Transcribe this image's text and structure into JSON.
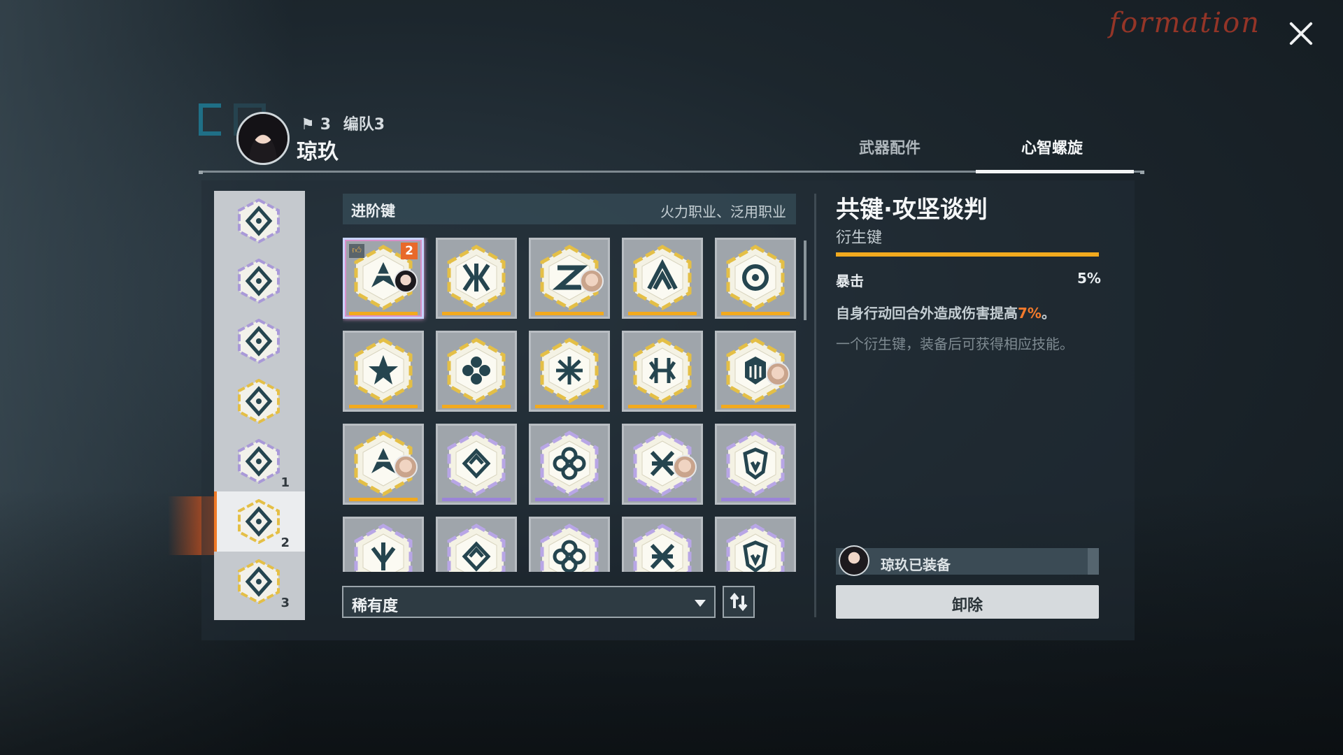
{
  "watermark": "formation",
  "character": {
    "team_number": "3",
    "team_name": "编队3",
    "name": "琼玖"
  },
  "tabs": [
    {
      "label": "武器配件",
      "active": false
    },
    {
      "label": "心智螺旋",
      "active": true
    }
  ],
  "sidebar": {
    "items": [
      {
        "icon": "diamond-rune-icon",
        "count": ""
      },
      {
        "icon": "tree-rune-icon",
        "count": ""
      },
      {
        "icon": "knot-rune-icon",
        "count": ""
      },
      {
        "icon": "star-rune-icon",
        "count": ""
      },
      {
        "icon": "eye-rune-icon",
        "count": "1"
      },
      {
        "icon": "arrow-rune-icon",
        "count": "2",
        "active": true
      },
      {
        "icon": "s-rune-icon",
        "count": "3"
      }
    ]
  },
  "category": {
    "title": "进阶键",
    "subtitle": "火力职业、泛用职业"
  },
  "keys": [
    {
      "icon": "arrow-key-icon",
      "rarity": "gold",
      "owner": "dark",
      "badge": "2",
      "selected": true,
      "recommended": true
    },
    {
      "icon": "wave-key-icon",
      "rarity": "gold"
    },
    {
      "icon": "z-key-icon",
      "rarity": "gold",
      "owner": "light"
    },
    {
      "icon": "peak-key-icon",
      "rarity": "gold"
    },
    {
      "icon": "orbit-key-icon",
      "rarity": "gold"
    },
    {
      "icon": "star-key-icon",
      "rarity": "gold"
    },
    {
      "icon": "clover-key-icon",
      "rarity": "gold"
    },
    {
      "icon": "snowflake-key-icon",
      "rarity": "gold"
    },
    {
      "icon": "spine-key-icon",
      "rarity": "gold"
    },
    {
      "icon": "crown-key-icon",
      "rarity": "gold",
      "owner": "light"
    },
    {
      "icon": "compass-key-icon",
      "rarity": "gold",
      "owner": "light"
    },
    {
      "icon": "diamond-key-icon",
      "rarity": "purple"
    },
    {
      "icon": "flower-key-icon",
      "rarity": "purple"
    },
    {
      "icon": "lattice-key-icon",
      "rarity": "purple",
      "owner": "light"
    },
    {
      "icon": "mask-key-icon",
      "rarity": "purple"
    },
    {
      "icon": "gem-key-icon",
      "rarity": "purple"
    },
    {
      "icon": "cube-key-icon",
      "rarity": "purple"
    },
    {
      "icon": "x-key-icon",
      "rarity": "purple"
    },
    {
      "icon": "spear-key-icon",
      "rarity": "purple"
    },
    {
      "icon": "pillar-key-icon",
      "rarity": "purple"
    }
  ],
  "sort": {
    "label": "稀有度"
  },
  "detail": {
    "title": "共键·攻坚谈判",
    "subtitle": "衍生键",
    "stat_name": "暴击",
    "stat_value": "5%",
    "effect_before": "自身行动回合外造成伤害提高",
    "effect_highlight": "7%",
    "effect_after": "。",
    "flavor": "一个衍生键，装备后可获得相应技能。",
    "equipped_text": "琼玖已装备",
    "unequip_label": "卸除"
  },
  "colors": {
    "accent_orange": "#f07a28",
    "gold_rarity": "#f2aa1e",
    "purple_rarity": "#9b84d8",
    "highlight_text": "#f27a2c"
  }
}
